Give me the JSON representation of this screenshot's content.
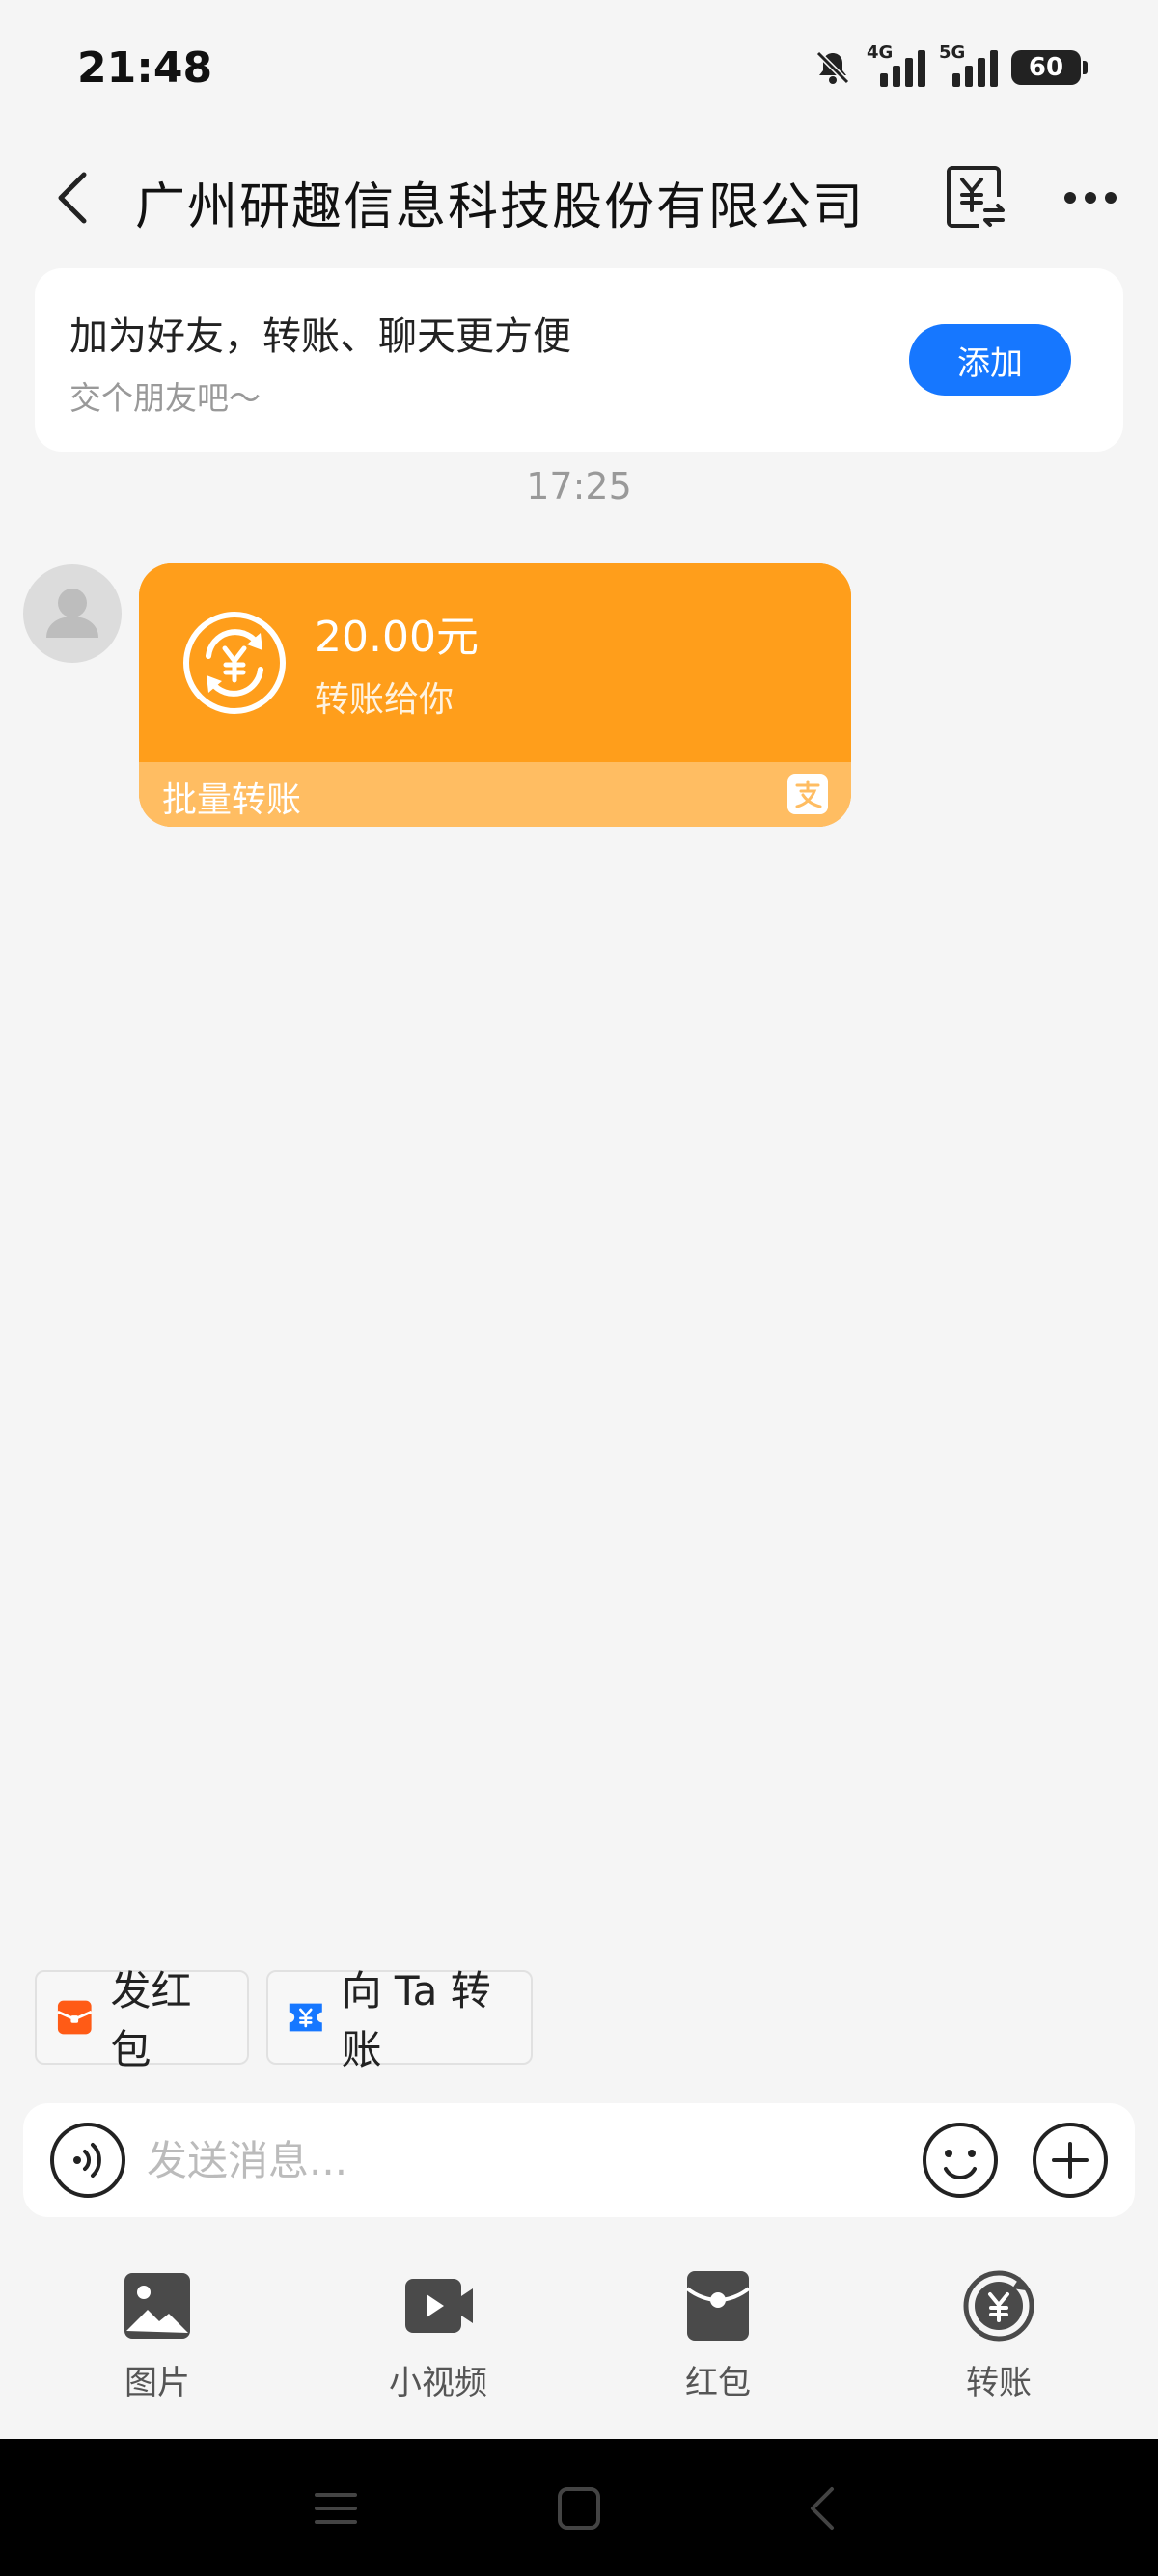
{
  "status_bar": {
    "time": "21:48",
    "network_1": "4G",
    "network_2": "5G",
    "battery": "60"
  },
  "nav": {
    "title": "广州研趣信息科技股份有限公司"
  },
  "friend_card": {
    "title": "加为好友，转账、聊天更方便",
    "subtitle": "交个朋友吧～",
    "add_label": "添加"
  },
  "chat": {
    "timestamp": "17:25",
    "message": {
      "amount": "20.00元",
      "description": "转账给你",
      "footer": "批量转账"
    }
  },
  "quick_actions": {
    "red_packet_label": "发红包",
    "transfer_label": "向 Ta 转账"
  },
  "input": {
    "placeholder": "发送消息..."
  },
  "tools": {
    "photo_label": "图片",
    "video_label": "小视频",
    "red_packet_label": "红包",
    "transfer_label": "转账"
  },
  "colors": {
    "accent": "#1677ff",
    "transfer_orange": "#ff9e1b",
    "transfer_footer": "#ffbd62",
    "red_packet": "#ff5b16"
  }
}
